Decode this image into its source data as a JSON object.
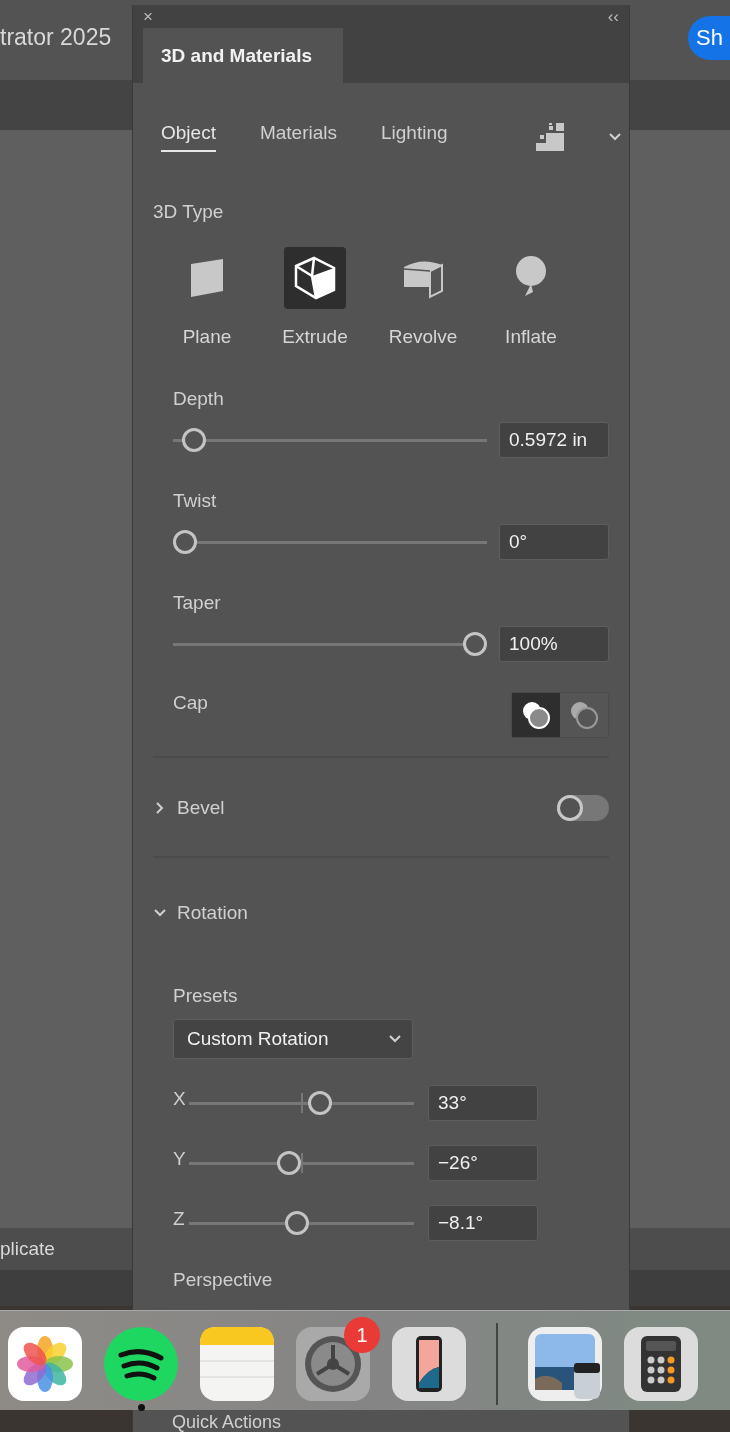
{
  "app": {
    "title": "trator 2025",
    "share_button": "Sh",
    "bottom_bar_text": "plicate"
  },
  "panel": {
    "close": "×",
    "collapse": "‹‹",
    "tab": "3D and Materials"
  },
  "subtabs": [
    {
      "label": "Object",
      "selected": true
    },
    {
      "label": "Materials",
      "selected": false
    },
    {
      "label": "Lighting",
      "selected": false
    }
  ],
  "type_label": "3D Type",
  "types": [
    {
      "label": "Plane",
      "kind": "plane",
      "selected": false
    },
    {
      "label": "Extrude",
      "kind": "extrude",
      "selected": true
    },
    {
      "label": "Revolve",
      "kind": "revolve",
      "selected": false
    },
    {
      "label": "Inflate",
      "kind": "inflate",
      "selected": false
    }
  ],
  "sliders": [
    {
      "label": "Depth",
      "level": 0.03,
      "value": "0.5972 in"
    },
    {
      "label": "Twist",
      "level": 0,
      "value": "0°"
    },
    {
      "label": "Taper",
      "level": 1,
      "value": "100%"
    }
  ],
  "cap": {
    "label": "Cap",
    "options": [
      {
        "kind": "solid",
        "selected": true
      },
      {
        "kind": "hollow",
        "selected": false
      }
    ]
  },
  "bevel": {
    "label": "Bevel",
    "expanded": false,
    "on": false
  },
  "rotation": {
    "label": "Rotation",
    "expanded": true,
    "presets_label": "Presets",
    "preset": "Custom Rotation",
    "axes": [
      {
        "label": "X",
        "level": 0.59,
        "value": "33°"
      },
      {
        "label": "Y",
        "level": 0.44,
        "value": "−26°"
      },
      {
        "label": "Z",
        "level": 0.48,
        "value": "−8.1°"
      }
    ]
  },
  "perspective_label": "Perspective",
  "quick_actions_label": "Quick Actions",
  "dock": {
    "apps": [
      {
        "kind": "photos",
        "running": false
      },
      {
        "kind": "spotify",
        "running": true
      },
      {
        "kind": "notes",
        "running": false
      },
      {
        "kind": "settings",
        "running": false,
        "badge": "1"
      },
      {
        "kind": "phone",
        "running": false
      },
      {
        "kind": "separator"
      },
      {
        "kind": "preview",
        "running": false
      },
      {
        "kind": "calculator",
        "running": false
      }
    ]
  }
}
